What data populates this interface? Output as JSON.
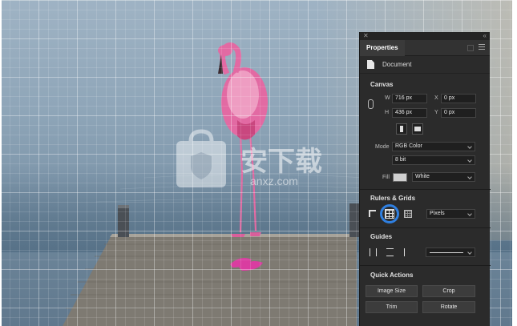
{
  "panel": {
    "title": "Properties",
    "document_label": "Document",
    "canvas": {
      "title": "Canvas",
      "width_label": "W",
      "width_value": "716 px",
      "height_label": "H",
      "height_value": "436 px",
      "x_label": "X",
      "x_value": "0 px",
      "y_label": "Y",
      "y_value": "0 px",
      "mode_label": "Mode",
      "mode_value": "RGB Color",
      "bit_value": "8 bit",
      "fill_label": "Fill",
      "fill_value": "White",
      "fill_color": "#d0d0d0"
    },
    "rulers": {
      "title": "Rulers & Grids",
      "units_value": "Pixels",
      "active_color": "#2f7fe0"
    },
    "guides": {
      "title": "Guides"
    },
    "quick_actions": {
      "title": "Quick Actions",
      "buttons": [
        "Image Size",
        "Crop",
        "Trim",
        "Rotate"
      ]
    }
  },
  "watermark": {
    "text": "安下载",
    "sub": "anxz.com"
  }
}
